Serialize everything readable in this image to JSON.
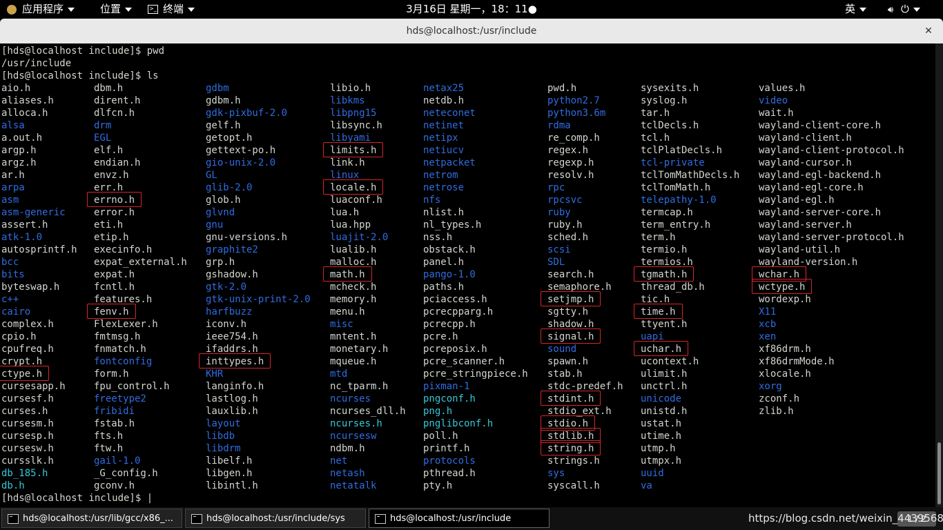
{
  "topbar": {
    "apps_label": "应用程序",
    "places_label": "位置",
    "terminal_label": "终端",
    "datetime": "3月16日 星期一，18：11●",
    "input_method": "英"
  },
  "window": {
    "title": "hds@localhost:/usr/include"
  },
  "terminal": {
    "lines": [
      "[hds@localhost include]$ pwd",
      "/usr/include",
      "[hds@localhost include]$ ls"
    ],
    "prompt": "[hds@localhost include]$ |"
  },
  "listing": {
    "columns": [
      [
        {
          "n": "aio.h",
          "t": "f"
        },
        {
          "n": "aliases.h",
          "t": "f"
        },
        {
          "n": "alloca.h",
          "t": "f"
        },
        {
          "n": "alsa",
          "t": "d"
        },
        {
          "n": "a.out.h",
          "t": "f"
        },
        {
          "n": "argp.h",
          "t": "f"
        },
        {
          "n": "argz.h",
          "t": "f"
        },
        {
          "n": "ar.h",
          "t": "f"
        },
        {
          "n": "arpa",
          "t": "d"
        },
        {
          "n": "asm",
          "t": "d"
        },
        {
          "n": "asm-generic",
          "t": "d"
        },
        {
          "n": "assert.h",
          "t": "f"
        },
        {
          "n": "atk-1.0",
          "t": "d"
        },
        {
          "n": "autosprintf.h",
          "t": "f"
        },
        {
          "n": "bcc",
          "t": "d"
        },
        {
          "n": "bits",
          "t": "d"
        },
        {
          "n": "byteswap.h",
          "t": "f"
        },
        {
          "n": "c++",
          "t": "d"
        },
        {
          "n": "cairo",
          "t": "d"
        },
        {
          "n": "complex.h",
          "t": "f"
        },
        {
          "n": "cpio.h",
          "t": "f"
        },
        {
          "n": "cpufreq.h",
          "t": "f"
        },
        {
          "n": "crypt.h",
          "t": "f"
        },
        {
          "n": "ctype.h",
          "t": "f"
        },
        {
          "n": "cursesapp.h",
          "t": "f"
        },
        {
          "n": "cursesf.h",
          "t": "f"
        },
        {
          "n": "curses.h",
          "t": "f"
        },
        {
          "n": "cursesm.h",
          "t": "f"
        },
        {
          "n": "cursesp.h",
          "t": "f"
        },
        {
          "n": "cursesw.h",
          "t": "f"
        },
        {
          "n": "cursslk.h",
          "t": "f"
        },
        {
          "n": "db_185.h",
          "t": "l"
        },
        {
          "n": "db.h",
          "t": "l"
        }
      ],
      [
        {
          "n": "dbm.h",
          "t": "f"
        },
        {
          "n": "dirent.h",
          "t": "f"
        },
        {
          "n": "dlfcn.h",
          "t": "f"
        },
        {
          "n": "drm",
          "t": "d"
        },
        {
          "n": "EGL",
          "t": "d"
        },
        {
          "n": "elf.h",
          "t": "f"
        },
        {
          "n": "endian.h",
          "t": "f"
        },
        {
          "n": "envz.h",
          "t": "f"
        },
        {
          "n": "err.h",
          "t": "f"
        },
        {
          "n": "errno.h",
          "t": "f"
        },
        {
          "n": "error.h",
          "t": "f"
        },
        {
          "n": "eti.h",
          "t": "f"
        },
        {
          "n": "etip.h",
          "t": "f"
        },
        {
          "n": "execinfo.h",
          "t": "f"
        },
        {
          "n": "expat_external.h",
          "t": "f"
        },
        {
          "n": "expat.h",
          "t": "f"
        },
        {
          "n": "fcntl.h",
          "t": "f"
        },
        {
          "n": "features.h",
          "t": "f"
        },
        {
          "n": "fenv.h",
          "t": "f"
        },
        {
          "n": "FlexLexer.h",
          "t": "f"
        },
        {
          "n": "fmtmsg.h",
          "t": "f"
        },
        {
          "n": "fnmatch.h",
          "t": "f"
        },
        {
          "n": "fontconfig",
          "t": "d"
        },
        {
          "n": "form.h",
          "t": "f"
        },
        {
          "n": "fpu_control.h",
          "t": "f"
        },
        {
          "n": "freetype2",
          "t": "d"
        },
        {
          "n": "fribidi",
          "t": "d"
        },
        {
          "n": "fstab.h",
          "t": "f"
        },
        {
          "n": "fts.h",
          "t": "f"
        },
        {
          "n": "ftw.h",
          "t": "f"
        },
        {
          "n": "gail-1.0",
          "t": "d"
        },
        {
          "n": "_G_config.h",
          "t": "f"
        },
        {
          "n": "gconv.h",
          "t": "f"
        }
      ],
      [
        {
          "n": "gdbm",
          "t": "d"
        },
        {
          "n": "gdbm.h",
          "t": "f"
        },
        {
          "n": "gdk-pixbuf-2.0",
          "t": "d"
        },
        {
          "n": "gelf.h",
          "t": "f"
        },
        {
          "n": "getopt.h",
          "t": "f"
        },
        {
          "n": "gettext-po.h",
          "t": "f"
        },
        {
          "n": "gio-unix-2.0",
          "t": "d"
        },
        {
          "n": "GL",
          "t": "d"
        },
        {
          "n": "glib-2.0",
          "t": "d"
        },
        {
          "n": "glob.h",
          "t": "f"
        },
        {
          "n": "glvnd",
          "t": "d"
        },
        {
          "n": "gnu",
          "t": "d"
        },
        {
          "n": "gnu-versions.h",
          "t": "f"
        },
        {
          "n": "graphite2",
          "t": "d"
        },
        {
          "n": "grp.h",
          "t": "f"
        },
        {
          "n": "gshadow.h",
          "t": "f"
        },
        {
          "n": "gtk-2.0",
          "t": "d"
        },
        {
          "n": "gtk-unix-print-2.0",
          "t": "d"
        },
        {
          "n": "harfbuzz",
          "t": "d"
        },
        {
          "n": "iconv.h",
          "t": "f"
        },
        {
          "n": "ieee754.h",
          "t": "f"
        },
        {
          "n": "ifaddrs.h",
          "t": "f"
        },
        {
          "n": "inttypes.h",
          "t": "f"
        },
        {
          "n": "KHR",
          "t": "d"
        },
        {
          "n": "langinfo.h",
          "t": "f"
        },
        {
          "n": "lastlog.h",
          "t": "f"
        },
        {
          "n": "lauxlib.h",
          "t": "f"
        },
        {
          "n": "layout",
          "t": "d"
        },
        {
          "n": "libdb",
          "t": "d"
        },
        {
          "n": "libdrm",
          "t": "d"
        },
        {
          "n": "libelf.h",
          "t": "f"
        },
        {
          "n": "libgen.h",
          "t": "f"
        },
        {
          "n": "libintl.h",
          "t": "f"
        }
      ],
      [
        {
          "n": "libio.h",
          "t": "f"
        },
        {
          "n": "libkms",
          "t": "d"
        },
        {
          "n": "libpng15",
          "t": "d"
        },
        {
          "n": "libsync.h",
          "t": "f"
        },
        {
          "n": "libyami",
          "t": "d"
        },
        {
          "n": "limits.h",
          "t": "f"
        },
        {
          "n": "link.h",
          "t": "f"
        },
        {
          "n": "linux",
          "t": "d"
        },
        {
          "n": "locale.h",
          "t": "f"
        },
        {
          "n": "luaconf.h",
          "t": "f"
        },
        {
          "n": "lua.h",
          "t": "f"
        },
        {
          "n": "lua.hpp",
          "t": "f"
        },
        {
          "n": "luajit-2.0",
          "t": "d"
        },
        {
          "n": "lualib.h",
          "t": "f"
        },
        {
          "n": "malloc.h",
          "t": "f"
        },
        {
          "n": "math.h",
          "t": "f"
        },
        {
          "n": "mcheck.h",
          "t": "f"
        },
        {
          "n": "memory.h",
          "t": "f"
        },
        {
          "n": "menu.h",
          "t": "f"
        },
        {
          "n": "misc",
          "t": "d"
        },
        {
          "n": "mntent.h",
          "t": "f"
        },
        {
          "n": "monetary.h",
          "t": "f"
        },
        {
          "n": "mqueue.h",
          "t": "f"
        },
        {
          "n": "mtd",
          "t": "d"
        },
        {
          "n": "nc_tparm.h",
          "t": "f"
        },
        {
          "n": "ncurses",
          "t": "d"
        },
        {
          "n": "ncurses_dll.h",
          "t": "f"
        },
        {
          "n": "ncurses.h",
          "t": "l"
        },
        {
          "n": "ncursesw",
          "t": "d"
        },
        {
          "n": "ndbm.h",
          "t": "f"
        },
        {
          "n": "net",
          "t": "d"
        },
        {
          "n": "netash",
          "t": "d"
        },
        {
          "n": "netatalk",
          "t": "d"
        }
      ],
      [
        {
          "n": "netax25",
          "t": "d"
        },
        {
          "n": "netdb.h",
          "t": "f"
        },
        {
          "n": "neteconet",
          "t": "d"
        },
        {
          "n": "netinet",
          "t": "d"
        },
        {
          "n": "netipx",
          "t": "d"
        },
        {
          "n": "netiucv",
          "t": "d"
        },
        {
          "n": "netpacket",
          "t": "d"
        },
        {
          "n": "netrom",
          "t": "d"
        },
        {
          "n": "netrose",
          "t": "d"
        },
        {
          "n": "nfs",
          "t": "d"
        },
        {
          "n": "nlist.h",
          "t": "f"
        },
        {
          "n": "nl_types.h",
          "t": "f"
        },
        {
          "n": "nss.h",
          "t": "f"
        },
        {
          "n": "obstack.h",
          "t": "f"
        },
        {
          "n": "panel.h",
          "t": "f"
        },
        {
          "n": "pango-1.0",
          "t": "d"
        },
        {
          "n": "paths.h",
          "t": "f"
        },
        {
          "n": "pciaccess.h",
          "t": "f"
        },
        {
          "n": "pcrecpparg.h",
          "t": "f"
        },
        {
          "n": "pcrecpp.h",
          "t": "f"
        },
        {
          "n": "pcre.h",
          "t": "f"
        },
        {
          "n": "pcreposix.h",
          "t": "f"
        },
        {
          "n": "pcre_scanner.h",
          "t": "f"
        },
        {
          "n": "pcre_stringpiece.h",
          "t": "f"
        },
        {
          "n": "pixman-1",
          "t": "d"
        },
        {
          "n": "pngconf.h",
          "t": "l"
        },
        {
          "n": "png.h",
          "t": "l"
        },
        {
          "n": "pnglibconf.h",
          "t": "l"
        },
        {
          "n": "poll.h",
          "t": "f"
        },
        {
          "n": "printf.h",
          "t": "f"
        },
        {
          "n": "protocols",
          "t": "d"
        },
        {
          "n": "pthread.h",
          "t": "f"
        },
        {
          "n": "pty.h",
          "t": "f"
        }
      ],
      [
        {
          "n": "pwd.h",
          "t": "f"
        },
        {
          "n": "python2.7",
          "t": "d"
        },
        {
          "n": "python3.6m",
          "t": "d"
        },
        {
          "n": "rdma",
          "t": "d"
        },
        {
          "n": "re_comp.h",
          "t": "f"
        },
        {
          "n": "regex.h",
          "t": "f"
        },
        {
          "n": "regexp.h",
          "t": "f"
        },
        {
          "n": "resolv.h",
          "t": "f"
        },
        {
          "n": "rpc",
          "t": "d"
        },
        {
          "n": "rpcsvc",
          "t": "d"
        },
        {
          "n": "ruby",
          "t": "d"
        },
        {
          "n": "ruby.h",
          "t": "f"
        },
        {
          "n": "sched.h",
          "t": "f"
        },
        {
          "n": "scsi",
          "t": "d"
        },
        {
          "n": "SDL",
          "t": "d"
        },
        {
          "n": "search.h",
          "t": "f"
        },
        {
          "n": "semaphore.h",
          "t": "f"
        },
        {
          "n": "setjmp.h",
          "t": "f"
        },
        {
          "n": "sgtty.h",
          "t": "f"
        },
        {
          "n": "shadow.h",
          "t": "f"
        },
        {
          "n": "signal.h",
          "t": "f"
        },
        {
          "n": "sound",
          "t": "d"
        },
        {
          "n": "spawn.h",
          "t": "f"
        },
        {
          "n": "stab.h",
          "t": "f"
        },
        {
          "n": "stdc-predef.h",
          "t": "f"
        },
        {
          "n": "stdint.h",
          "t": "f"
        },
        {
          "n": "stdio_ext.h",
          "t": "f"
        },
        {
          "n": "stdio.h",
          "t": "f"
        },
        {
          "n": "stdlib.h",
          "t": "f"
        },
        {
          "n": "string.h",
          "t": "f"
        },
        {
          "n": "strings.h",
          "t": "f"
        },
        {
          "n": "sys",
          "t": "d"
        },
        {
          "n": "syscall.h",
          "t": "f"
        }
      ],
      [
        {
          "n": "sysexits.h",
          "t": "f"
        },
        {
          "n": "syslog.h",
          "t": "f"
        },
        {
          "n": "tar.h",
          "t": "f"
        },
        {
          "n": "tclDecls.h",
          "t": "f"
        },
        {
          "n": "tcl.h",
          "t": "f"
        },
        {
          "n": "tclPlatDecls.h",
          "t": "f"
        },
        {
          "n": "tcl-private",
          "t": "d"
        },
        {
          "n": "tclTomMathDecls.h",
          "t": "f"
        },
        {
          "n": "tclTomMath.h",
          "t": "f"
        },
        {
          "n": "telepathy-1.0",
          "t": "d"
        },
        {
          "n": "termcap.h",
          "t": "f"
        },
        {
          "n": "term_entry.h",
          "t": "f"
        },
        {
          "n": "term.h",
          "t": "f"
        },
        {
          "n": "termio.h",
          "t": "f"
        },
        {
          "n": "termios.h",
          "t": "f"
        },
        {
          "n": "tgmath.h",
          "t": "f"
        },
        {
          "n": "thread_db.h",
          "t": "f"
        },
        {
          "n": "tic.h",
          "t": "f"
        },
        {
          "n": "time.h",
          "t": "f"
        },
        {
          "n": "ttyent.h",
          "t": "f"
        },
        {
          "n": "uapi",
          "t": "d"
        },
        {
          "n": "uchar.h",
          "t": "f"
        },
        {
          "n": "ucontext.h",
          "t": "f"
        },
        {
          "n": "ulimit.h",
          "t": "f"
        },
        {
          "n": "unctrl.h",
          "t": "f"
        },
        {
          "n": "unicode",
          "t": "d"
        },
        {
          "n": "unistd.h",
          "t": "f"
        },
        {
          "n": "ustat.h",
          "t": "f"
        },
        {
          "n": "utime.h",
          "t": "f"
        },
        {
          "n": "utmp.h",
          "t": "f"
        },
        {
          "n": "utmpx.h",
          "t": "f"
        },
        {
          "n": "uuid",
          "t": "d"
        },
        {
          "n": "va",
          "t": "d"
        }
      ],
      [
        {
          "n": "values.h",
          "t": "f"
        },
        {
          "n": "video",
          "t": "d"
        },
        {
          "n": "wait.h",
          "t": "f"
        },
        {
          "n": "wayland-client-core.h",
          "t": "f"
        },
        {
          "n": "wayland-client.h",
          "t": "f"
        },
        {
          "n": "wayland-client-protocol.h",
          "t": "f"
        },
        {
          "n": "wayland-cursor.h",
          "t": "f"
        },
        {
          "n": "wayland-egl-backend.h",
          "t": "f"
        },
        {
          "n": "wayland-egl-core.h",
          "t": "f"
        },
        {
          "n": "wayland-egl.h",
          "t": "f"
        },
        {
          "n": "wayland-server-core.h",
          "t": "f"
        },
        {
          "n": "wayland-server.h",
          "t": "f"
        },
        {
          "n": "wayland-server-protocol.h",
          "t": "f"
        },
        {
          "n": "wayland-util.h",
          "t": "f"
        },
        {
          "n": "wayland-version.h",
          "t": "f"
        },
        {
          "n": "wchar.h",
          "t": "f"
        },
        {
          "n": "wctype.h",
          "t": "f"
        },
        {
          "n": "wordexp.h",
          "t": "f"
        },
        {
          "n": "X11",
          "t": "d"
        },
        {
          "n": "xcb",
          "t": "d"
        },
        {
          "n": "xen",
          "t": "d"
        },
        {
          "n": "xf86drm.h",
          "t": "f"
        },
        {
          "n": "xf86drmMode.h",
          "t": "f"
        },
        {
          "n": "xlocale.h",
          "t": "f"
        },
        {
          "n": "xorg",
          "t": "d"
        },
        {
          "n": "zconf.h",
          "t": "f"
        },
        {
          "n": "zlib.h",
          "t": "f"
        }
      ]
    ],
    "highlighted": [
      "errno.h",
      "fenv.h",
      "ctype.h",
      "inttypes.h",
      "limits.h",
      "locale.h",
      "math.h",
      "setjmp.h",
      "signal.h",
      "stdint.h",
      "stdio.h",
      "stdlib.h",
      "string.h",
      "tgmath.h",
      "time.h",
      "uchar.h",
      "wchar.h",
      "wctype.h"
    ],
    "colors": {
      "file": "#d3d7cf",
      "directory": "#2f6de1",
      "symlink": "#35c8d8",
      "highlight_box": "#d8262a"
    }
  },
  "taskbar": {
    "items": [
      {
        "label": "hds@localhost:/usr/lib/gcc/x86_...",
        "active": false
      },
      {
        "label": "hds@localhost:/usr/include/sys",
        "active": false
      },
      {
        "label": "hds@localhost:/usr/include",
        "active": true
      }
    ],
    "watermark": "https://blog.csdn.net/weixin_44395686",
    "pager": "1 / 2"
  }
}
